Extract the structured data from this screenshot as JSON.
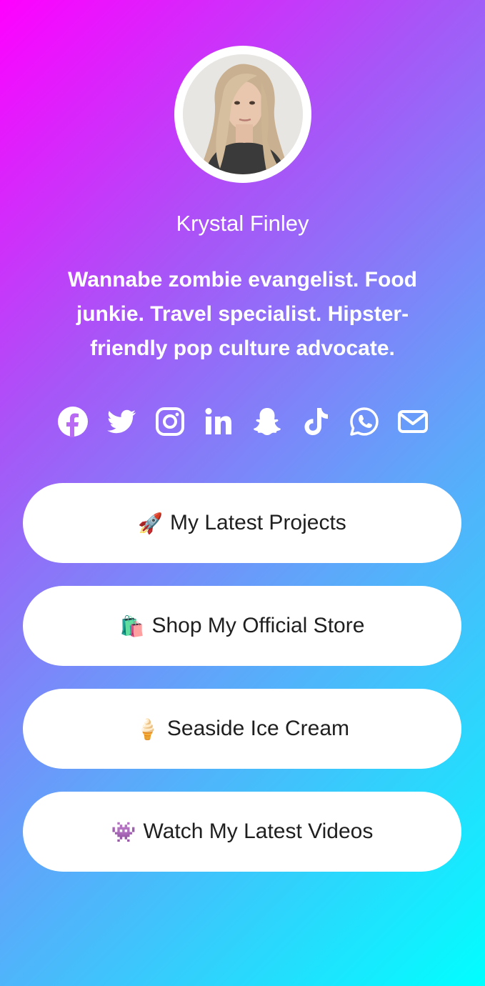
{
  "profile": {
    "name": "Krystal Finley",
    "bio": "Wannabe zombie evangelist. Food junkie. Travel specialist. Hipster-friendly pop culture advocate."
  },
  "social_icons": [
    {
      "name": "facebook-icon"
    },
    {
      "name": "twitter-icon"
    },
    {
      "name": "instagram-icon"
    },
    {
      "name": "linkedin-icon"
    },
    {
      "name": "snapchat-icon"
    },
    {
      "name": "tiktok-icon"
    },
    {
      "name": "whatsapp-icon"
    },
    {
      "name": "mail-icon"
    }
  ],
  "links": [
    {
      "emoji": "🚀",
      "label": "My Latest Projects"
    },
    {
      "emoji": "🛍️",
      "label": "Shop My Official Store"
    },
    {
      "emoji": "🍦",
      "label": "Seaside Ice Cream"
    },
    {
      "emoji": "👾",
      "label": "Watch My Latest Videos"
    }
  ],
  "colors": {
    "gradient_start": "#ff00ff",
    "gradient_mid": "#a855f7",
    "gradient_end": "#00ffff",
    "button_bg": "#ffffff",
    "button_text": "#1f1f1f"
  }
}
